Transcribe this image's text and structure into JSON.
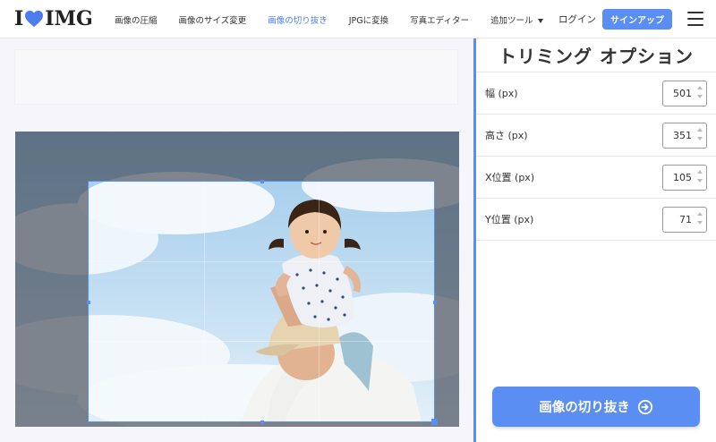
{
  "header": {
    "logo": {
      "left": "I",
      "right": "IMG",
      "heart_color": "#4d7cf0"
    },
    "nav": [
      {
        "label": "画像の圧縮",
        "active": false
      },
      {
        "label": "画像のサイズ変更",
        "active": false
      },
      {
        "label": "画像の切り抜き",
        "active": true
      },
      {
        "label": "JPGに変換",
        "active": false
      },
      {
        "label": "写真エディター",
        "active": false
      },
      {
        "label": "追加ツール",
        "active": false,
        "dropdown": true
      }
    ],
    "login_label": "ログイン",
    "signup_label": "サインアップ",
    "menu_icon": "hamburger-icon"
  },
  "panel": {
    "title": "トリミング オプション",
    "fields": [
      {
        "label": "幅 (px)",
        "value": "501"
      },
      {
        "label": "高さ (px)",
        "value": "351"
      },
      {
        "label": "X位置 (px)",
        "value": "105"
      },
      {
        "label": "Y位置 (px)",
        "value": "71"
      }
    ],
    "crop_button_label": "画像の切り抜き",
    "crop_button_icon": "arrow-circle-right-icon"
  },
  "colors": {
    "accent": "#5b8ef2",
    "active_nav": "#4d7cf0",
    "text": "#333333"
  }
}
